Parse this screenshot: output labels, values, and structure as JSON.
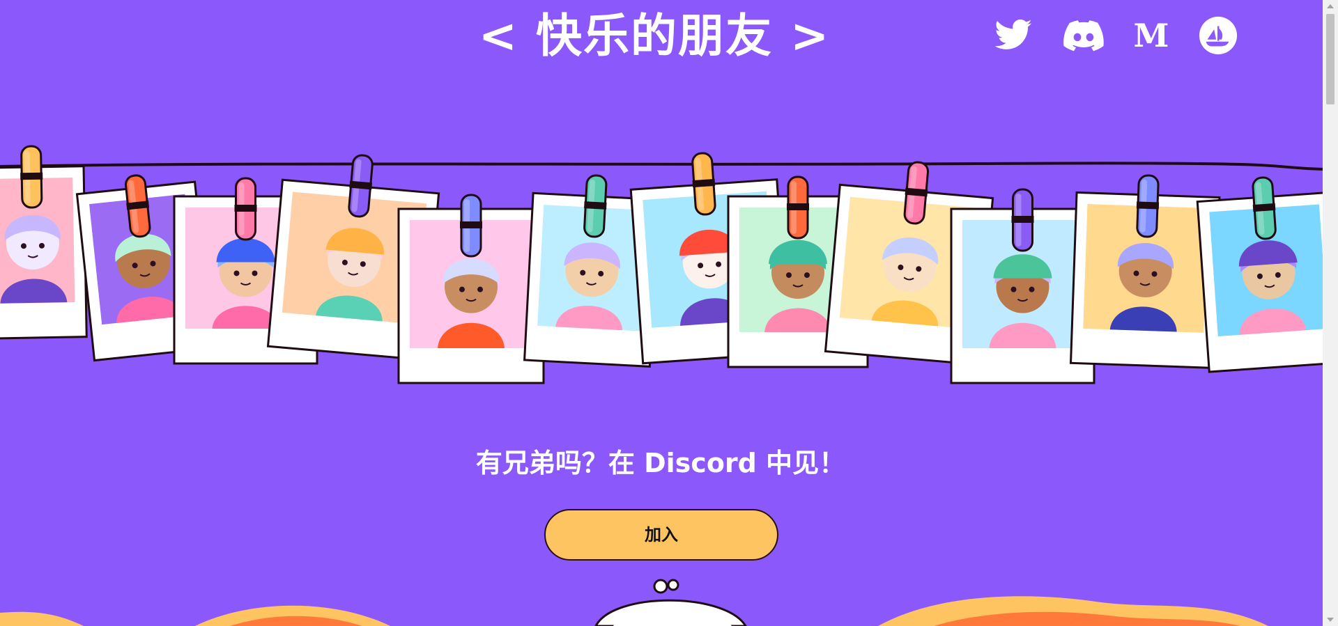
{
  "header": {
    "title": "< 快乐的朋友 >"
  },
  "socials": [
    {
      "name": "twitter-icon"
    },
    {
      "name": "discord-icon"
    },
    {
      "name": "medium-icon",
      "label": "M"
    },
    {
      "name": "opensea-icon"
    }
  ],
  "cta": {
    "text": "有兄弟吗？在 Discord 中见！",
    "button_label": "加入"
  },
  "colors": {
    "background": "#8b58fb",
    "button": "#ffc462",
    "clothesline": "#1f0b12"
  },
  "gallery": {
    "photos": [
      {
        "bg": "#ffb6c8",
        "skin": "#f1eaff",
        "hair": "#c7b7ff",
        "hat": "",
        "pin": "#ffc15b",
        "accent": "#6a46c9"
      },
      {
        "bg": "#9b6cf3",
        "skin": "#b97a4e",
        "hair": "#b8f0d8",
        "hat": "",
        "pin": "#ff6a3d",
        "accent": "#ff6aa8"
      },
      {
        "bg": "#ffc7e6",
        "skin": "#f2c6a1",
        "hair": "#8ab6ff",
        "hat": "#3d62f5",
        "pin": "#ff7aa8",
        "accent": "#ff6aa8"
      },
      {
        "bg": "#ffd0a8",
        "skin": "#f7ded0",
        "hair": "#ffd0e0",
        "hat": "#ffb347",
        "pin": "#8a5cf6",
        "accent": "#5ad1b5"
      },
      {
        "bg": "#ffc8ea",
        "skin": "#c98d62",
        "hair": "#d5dcff",
        "hat": "",
        "pin": "#7f8cff",
        "accent": "#ff5a2a"
      },
      {
        "bg": "#bdeeff",
        "skin": "#f3cfa9",
        "hair": "#cbb5ff",
        "hat": "",
        "pin": "#5ccdb0",
        "accent": "#ff9ac4"
      },
      {
        "bg": "#a8e8ff",
        "skin": "#fdf1ec",
        "hair": "#c7c0ff",
        "hat": "#ff4b3a",
        "pin": "#ffb74d",
        "accent": "#6a46c9"
      },
      {
        "bg": "#c8f5d8",
        "skin": "#c48b5f",
        "hair": "#3fbfa2",
        "hat": "#3fbfa2",
        "pin": "#ff6a3d",
        "accent": "#ff8ab0"
      },
      {
        "bg": "#ffe6a8",
        "skin": "#f9e0c4",
        "hair": "#c5cfff",
        "hat": "",
        "pin": "#ff7aa8",
        "accent": "#ffc24a"
      },
      {
        "bg": "#bfeaff",
        "skin": "#b9794d",
        "hair": "#cbb5ff",
        "hat": "#4cc49a",
        "pin": "#8a5cf6",
        "accent": "#ff9ac4"
      },
      {
        "bg": "#ffd98e",
        "skin": "#c98d62",
        "hair": "#a9a6ff",
        "hat": "",
        "pin": "#7f8cff",
        "accent": "#3b3fb5"
      },
      {
        "bg": "#7bd7ff",
        "skin": "#e9c7a1",
        "hair": "#a98bff",
        "hat": "#6a46c9",
        "pin": "#5ccdb0",
        "accent": "#ff9ac4"
      }
    ]
  }
}
